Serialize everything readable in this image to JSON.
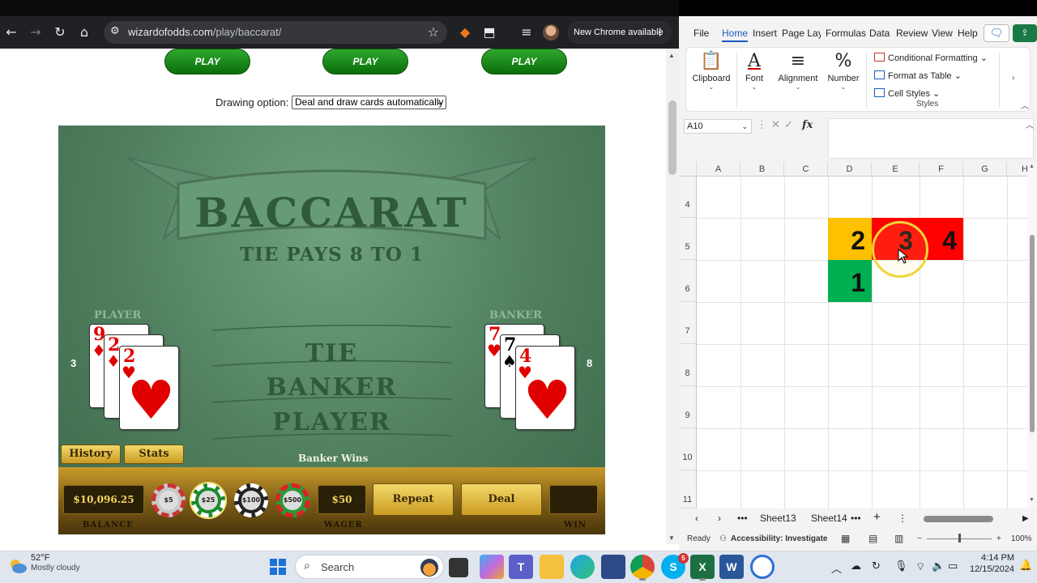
{
  "browser": {
    "url_host": "wizardofodds.com",
    "url_path": "/play/baccarat/",
    "update_label": "New Chrome available",
    "icons": [
      "back-arrow-icon",
      "forward-arrow-icon",
      "reload-icon",
      "home-icon",
      "tune-icon",
      "star-icon",
      "extension-icon",
      "puzzle-icon",
      "media-icon",
      "profile-avatar",
      "menu-dots-icon"
    ]
  },
  "page": {
    "play_buttons": [
      "PLAY",
      "PLAY",
      "PLAY"
    ],
    "drawing_label": "Drawing option:",
    "drawing_value": "Deal and draw cards automatically"
  },
  "baccarat": {
    "title": "BACCARAT",
    "subtitle": "TIE PAYS 8 TO 1",
    "player_label": "PLAYER",
    "banker_label": "BANKER",
    "bet_tie": "TIE",
    "bet_banker": "BANKER",
    "bet_player": "PLAYER",
    "player_score": "3",
    "banker_score": "8",
    "player_cards": [
      {
        "rank": "9",
        "suit": "♦"
      },
      {
        "rank": "2",
        "suit": "♦"
      },
      {
        "rank": "2",
        "suit": "♥"
      }
    ],
    "banker_cards": [
      {
        "rank": "7",
        "suit": "♥"
      },
      {
        "rank": "7",
        "suit": "♠"
      },
      {
        "rank": "4",
        "suit": "♥"
      }
    ],
    "history_label": "History",
    "stats_label": "Stats",
    "result_text": "Banker Wins",
    "balance_value": "$10,096.25",
    "balance_label": "BALANCE",
    "chips": [
      "$5",
      "$25",
      "$100",
      "$500"
    ],
    "wager_value": "$50",
    "wager_label": "WAGER",
    "repeat_label": "Repeat",
    "deal_label": "Deal",
    "win_value": "",
    "win_label": "WIN",
    "colors": {
      "felt": "#4f7f5f",
      "gold": "#c99b22"
    }
  },
  "excel": {
    "menu": [
      "File",
      "Home",
      "Insert",
      "Page Layo",
      "Formulas",
      "Data",
      "Review",
      "View",
      "Help"
    ],
    "ribbon": {
      "clipboard": "Clipboard",
      "font": "Font",
      "alignment": "Alignment",
      "number": "Number",
      "conditional_formatting": "Conditional Formatting",
      "format_as_table": "Format as Table",
      "cell_styles": "Cell Styles",
      "styles_group": "Styles"
    },
    "name_box": "A10",
    "fx_label": "fx",
    "columns": [
      "A",
      "B",
      "C",
      "D",
      "E",
      "F",
      "G",
      "H"
    ],
    "rows": [
      "4",
      "5",
      "6",
      "7",
      "8",
      "9",
      "10",
      "11"
    ],
    "cells": {
      "d5": "2",
      "e5": "3",
      "f5": "4",
      "d6": "1"
    },
    "cell_colors": {
      "d5": "#ffc000",
      "e5": "#ff0000",
      "f5": "#ff0000",
      "d6": "#00b050"
    },
    "sheets": [
      "Sheet13",
      "Sheet14"
    ],
    "status_ready": "Ready",
    "status_accessibility": "Accessibility: Investigate",
    "zoom": "100%"
  },
  "taskbar": {
    "temperature": "52°F",
    "condition": "Mostly cloudy",
    "search_label": "Search",
    "time": "4:14 PM",
    "date": "12/15/2024",
    "skype_badge": "5"
  }
}
